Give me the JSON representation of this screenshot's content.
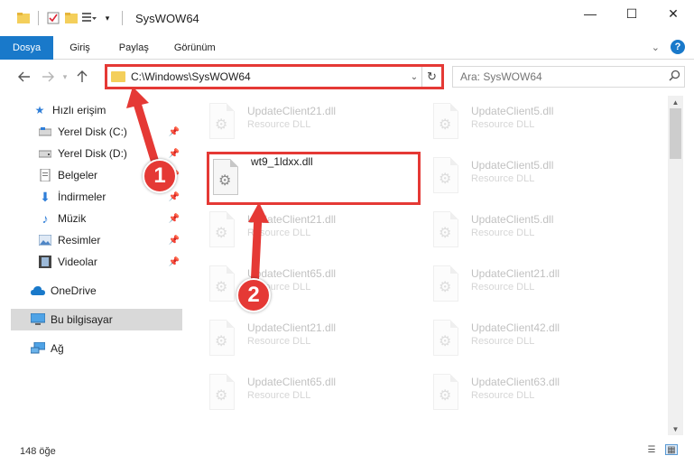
{
  "window": {
    "title": "SysWOW64",
    "minimize_label": "—",
    "maximize_label": "☐",
    "close_label": "✕"
  },
  "ribbon": {
    "tabs": [
      {
        "label": "Dosya"
      },
      {
        "label": "Giriş"
      },
      {
        "label": "Paylaş"
      },
      {
        "label": "Görünüm"
      }
    ],
    "help_label": "?",
    "collapse_label": "⌄"
  },
  "nav": {
    "address": "C:\\Windows\\SysWOW64",
    "search_placeholder": "Ara: SysWOW64"
  },
  "sidebar": {
    "items": [
      {
        "label": "Hızlı erişim"
      },
      {
        "label": "Yerel Disk (C:)"
      },
      {
        "label": "Yerel Disk (D:)"
      },
      {
        "label": "Belgeler"
      },
      {
        "label": "İndirmeler"
      },
      {
        "label": "Müzik"
      },
      {
        "label": "Resimler"
      },
      {
        "label": "Videolar"
      },
      {
        "label": "OneDrive"
      },
      {
        "label": "Bu bilgisayar"
      },
      {
        "label": "Ağ"
      }
    ]
  },
  "files": {
    "left": [
      {
        "name": "UpdateClient21.dll",
        "type": "Resource DLL"
      },
      {
        "name": "wt9_1ldxx.dll",
        "type": ""
      },
      {
        "name": "UpdateClient21.dll",
        "type": "Resource DLL"
      },
      {
        "name": "UpdateClient65.dll",
        "type": "Resource DLL"
      },
      {
        "name": "UpdateClient21.dll",
        "type": "Resource DLL"
      },
      {
        "name": "UpdateClient65.dll",
        "type": "Resource DLL"
      }
    ],
    "right": [
      {
        "name": "UpdateClient5.dll",
        "type": "Resource DLL"
      },
      {
        "name": "UpdateClient5.dll",
        "type": "Resource DLL"
      },
      {
        "name": "UpdateClient5.dll",
        "type": "Resource DLL"
      },
      {
        "name": "UpdateClient21.dll",
        "type": "Resource DLL"
      },
      {
        "name": "UpdateClient42.dll",
        "type": "Resource DLL"
      },
      {
        "name": "UpdateClient63.dll",
        "type": "Resource DLL"
      }
    ]
  },
  "status": {
    "item_count": "148 öğe"
  },
  "annotations": {
    "step1": "1",
    "step2": "2",
    "color": "#e53935"
  }
}
